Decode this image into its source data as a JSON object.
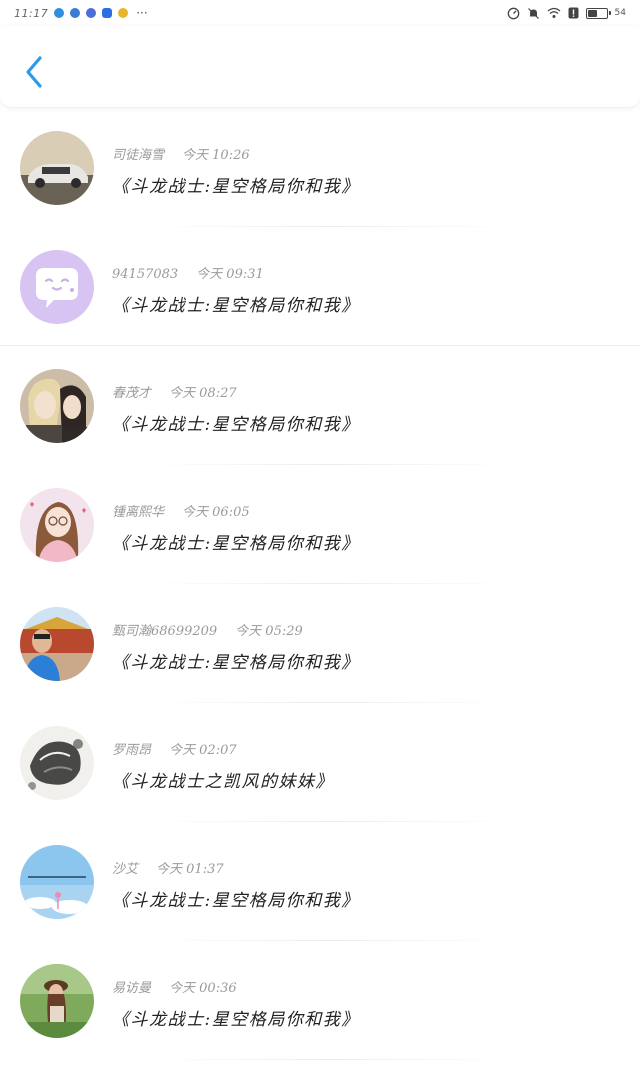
{
  "status_bar": {
    "time": "11:17",
    "more": "···",
    "battery_level": 0.54,
    "battery_text": "54"
  },
  "comments": [
    {
      "author": "司徒海雪",
      "time": "今天 10:26",
      "title": "《斗龙战士:星空格局你和我》"
    },
    {
      "author": "94157083",
      "time": "今天 09:31",
      "title": "《斗龙战士:星空格局你和我》"
    },
    {
      "author": "春茂才",
      "time": "今天 08:27",
      "title": "《斗龙战士:星空格局你和我》"
    },
    {
      "author": "锺离熙华",
      "time": "今天 06:05",
      "title": "《斗龙战士:星空格局你和我》"
    },
    {
      "author": "甄司瀚68699209",
      "time": "今天 05:29",
      "title": "《斗龙战士:星空格局你和我》"
    },
    {
      "author": "罗雨昂",
      "time": "今天 02:07",
      "title": "《斗龙战士之凯风的妹妹》"
    },
    {
      "author": "沙艾",
      "time": "今天 01:37",
      "title": "《斗龙战士:星空格局你和我》"
    },
    {
      "author": "易访曼",
      "time": "今天 00:36",
      "title": "《斗龙战士:星空格局你和我》"
    }
  ],
  "colors": {
    "accent": "#2a9be8",
    "text_primary": "#222222",
    "text_secondary": "#9a9a9a",
    "background": "#ffffff"
  }
}
